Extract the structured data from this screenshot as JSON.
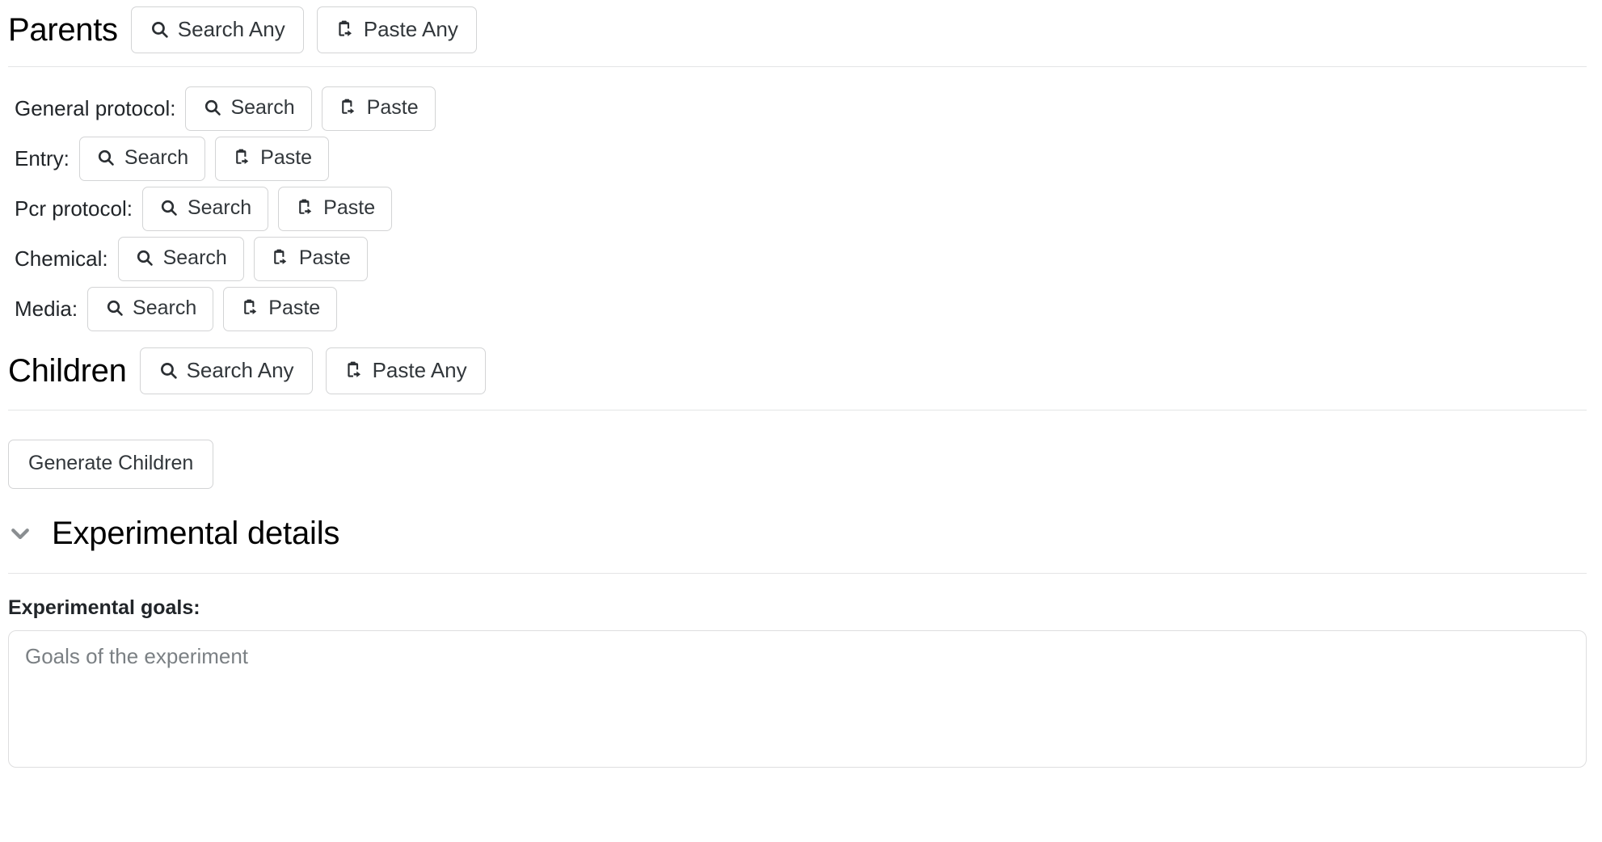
{
  "icons": {
    "search": "search-icon",
    "paste": "paste-clipboard-icon",
    "chevron": "chevron-down-icon"
  },
  "colors": {
    "page_background": "#ffffff",
    "text": "#212529",
    "heading": "#000000",
    "button_border": "#d3d4d5",
    "divider": "#e4e5e6",
    "placeholder": "#7b8084",
    "chevron": "#8a8e91"
  },
  "parents": {
    "title": "Parents",
    "search_any_label": "Search Any",
    "paste_any_label": "Paste Any",
    "fields": [
      {
        "label": "General protocol:",
        "search_label": "Search",
        "paste_label": "Paste"
      },
      {
        "label": "Entry:",
        "search_label": "Search",
        "paste_label": "Paste"
      },
      {
        "label": "Pcr protocol:",
        "search_label": "Search",
        "paste_label": "Paste"
      },
      {
        "label": "Chemical:",
        "search_label": "Search",
        "paste_label": "Paste"
      },
      {
        "label": "Media:",
        "search_label": "Search",
        "paste_label": "Paste"
      }
    ]
  },
  "children": {
    "title": "Children",
    "search_any_label": "Search Any",
    "paste_any_label": "Paste Any",
    "generate_label": "Generate Children"
  },
  "experimental_details": {
    "title": "Experimental details",
    "expanded": true,
    "goals_label": "Experimental goals:",
    "goals_value": "",
    "goals_placeholder": "Goals of the experiment"
  }
}
